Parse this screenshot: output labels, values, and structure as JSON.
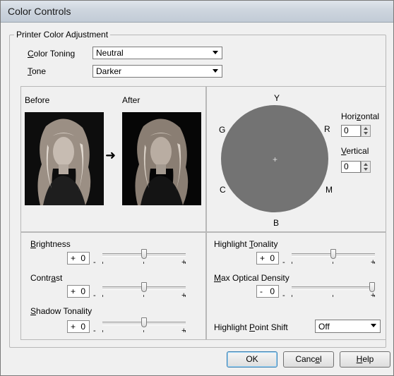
{
  "window": {
    "title": "Color Controls"
  },
  "printer_group": {
    "title": "Printer Color Adjustment",
    "color_toning": {
      "label_u": "C",
      "label_rest": "olor Toning",
      "value": "Neutral"
    },
    "tone": {
      "label_u": "T",
      "label_rest": "one",
      "value": "Darker"
    }
  },
  "preview": {
    "before_label": "Before",
    "after_label": "After"
  },
  "color_wheel": {
    "labels": {
      "y": "Y",
      "r": "R",
      "m": "M",
      "b": "B",
      "c": "C",
      "g": "G"
    },
    "center": "+",
    "fill_color": "#737373",
    "horizontal": {
      "label_pre": "Hori",
      "label_u": "z",
      "label_post": "ontal",
      "value": "0"
    },
    "vertical": {
      "label_u": "V",
      "label_rest": "ertical",
      "value": "0"
    }
  },
  "sliders_left": {
    "brightness": {
      "label_u": "B",
      "label_rest": "rightness",
      "sign": "+",
      "value": "0",
      "position": 0.5
    },
    "contrast": {
      "label_pre": "Contr",
      "label_u": "a",
      "label_post": "st",
      "sign": "+",
      "value": "0",
      "position": 0.5
    },
    "shadow_tonality": {
      "label_u": "S",
      "label_rest": "hadow Tonality",
      "sign": "+",
      "value": "0",
      "position": 0.5
    }
  },
  "sliders_right": {
    "highlight_tonality": {
      "label_pre": "Highlight ",
      "label_u": "T",
      "label_post": "onality",
      "sign": "+",
      "value": "0",
      "position": 0.5
    },
    "max_optical_density": {
      "label_u": "M",
      "label_rest": "ax Optical Density",
      "sign": "-",
      "value": "0",
      "position": 1.0
    }
  },
  "slider_marks": {
    "minus": "-",
    "plus": "+"
  },
  "highlight_point_shift": {
    "label_pre": "Highlight ",
    "label_u": "P",
    "label_post": "oint Shift",
    "value": "Off"
  },
  "buttons": {
    "ok": "OK",
    "cancel": {
      "pre": "Canc",
      "u": "e",
      "post": "l"
    },
    "help": {
      "u": "H",
      "rest": "elp"
    }
  }
}
